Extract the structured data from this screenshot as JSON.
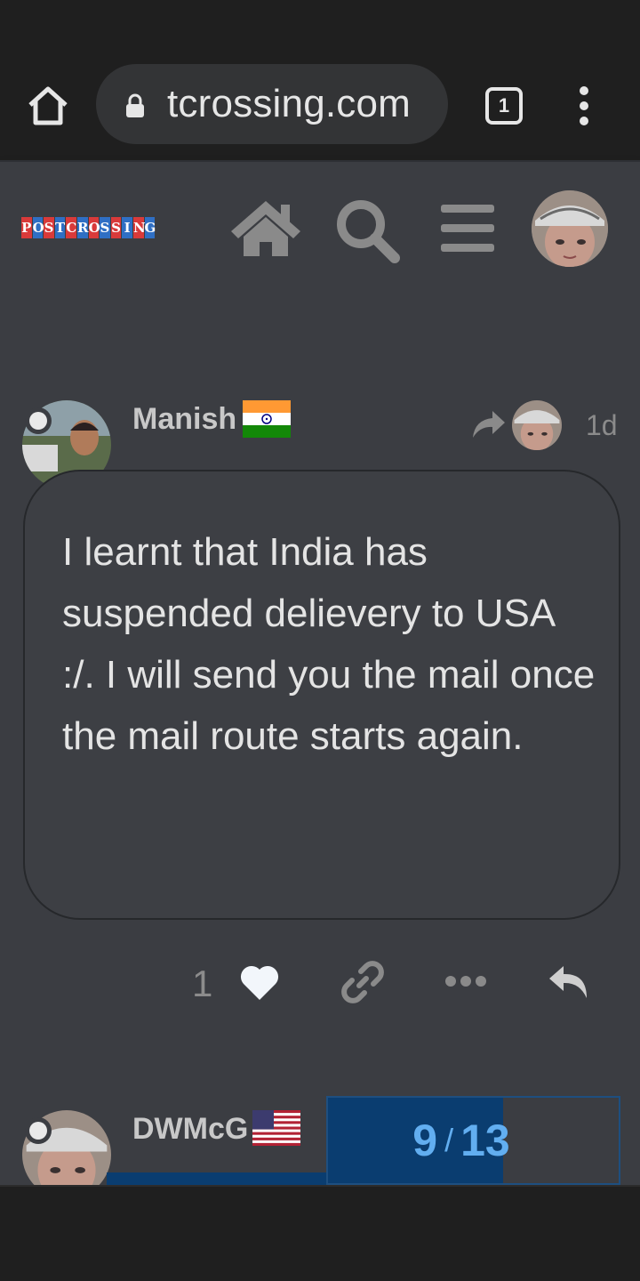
{
  "browser": {
    "url": "tcrossing.com",
    "tab_count": "1"
  },
  "site": {
    "logo_letters": [
      "P",
      "O",
      "S",
      "T",
      "C",
      "R",
      "O",
      "S",
      "S",
      "I",
      "N",
      "G"
    ],
    "logo_colors": [
      "#d93a3a",
      "#2f6fc4"
    ]
  },
  "post": {
    "username": "Manish",
    "age": "1d",
    "text": "I learnt that India has suspended delievery to USA :/. I will send you the mail once the mail route starts again.",
    "like_count": "1"
  },
  "next_post": {
    "username": "DWMcG"
  },
  "progress": {
    "current": "9",
    "separator": "/",
    "total": "13",
    "fraction": 0.6923
  },
  "colors": {
    "accent": "#62aef0",
    "progress_bg": "#0a3d70"
  }
}
